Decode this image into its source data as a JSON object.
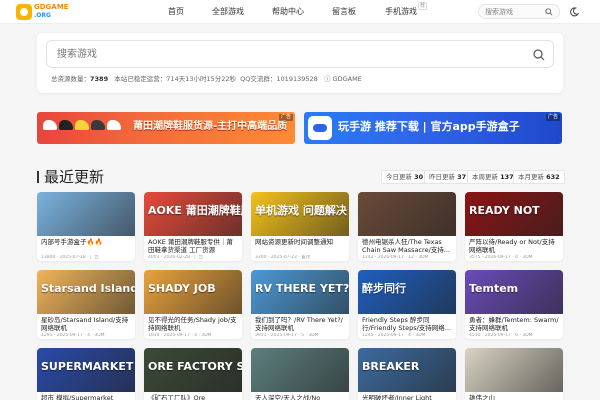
{
  "logo": {
    "line1": "GDGAME",
    "line2": ".ORG"
  },
  "nav": {
    "home": "首页",
    "all_games": "全部游戏",
    "help": "帮助中心",
    "guestbook": "留言板",
    "mobile_games": "手机游戏",
    "mobile_badge": "荐",
    "search_placeholder": "搜索游戏"
  },
  "search": {
    "placeholder": "搜索游戏"
  },
  "stats": {
    "total_label": "总资源数量：",
    "total_value": "7389",
    "uptime": "本站已稳定运营：714天13小时15分22秒",
    "qq_label": "QQ交流群：",
    "qq_value": "1019139528",
    "site": "GDGAME"
  },
  "banners": {
    "left_text": "莆田潮牌鞋服货源-主打中高端品质",
    "left_tag": "广告",
    "right_text": "玩手游 推荐下载 | 官方app手游盒子",
    "right_tag": "广告"
  },
  "section": {
    "title": "最近更新"
  },
  "filters": [
    {
      "label": "今日更新",
      "value": "30"
    },
    {
      "label": "昨日更新",
      "value": "37"
    },
    {
      "label": "本周更新",
      "value": "137"
    },
    {
      "label": "本月更新",
      "value": "632"
    }
  ],
  "cards": [
    {
      "title": "内部号手游盒子🔥🔥",
      "meta": "13800 · 2025-07-18 · 广告",
      "art": "",
      "color": "#7bb3e0"
    },
    {
      "title": "AOKE 莆田潮牌鞋服专供｜莆田鞋拿货渠道 工厂货源",
      "meta": "4003 · 2026-02-28 · 广告",
      "art": "AOKE 莆田潮牌鞋服",
      "color": "#e64a3a"
    },
    {
      "title": "网站资源更新时间调整通知",
      "meta": "3300 · 2025-07-23 · 置顶",
      "art": "单机游戏 问题解决",
      "color": "#f5c21a"
    },
    {
      "title": "德州电锯杀人狂/The Texas Chain Saw Massacre/支持...",
      "meta": "1242 · 2026-09-17 · 12 · 3DM",
      "art": "",
      "color": "#6b4a38"
    },
    {
      "title": "严阵以待/Ready or Not/支持网络联机",
      "meta": "3575 · 2026-09-17 · 4 · 3DM",
      "art": "READY NOT",
      "color": "#8a1414"
    },
    {
      "title": "星砂岛/Starsand Island/支持网络联机",
      "meta": "1291 · 2025-09-17 · 4 · 3DM",
      "art": "Starsand Island",
      "color": "#f0b45a"
    },
    {
      "title": "见不得光的任务/Shady job/支持网络联机",
      "meta": "1034 · 2025-09-17 · 4 · 3DM",
      "art": "SHADY JOB",
      "color": "#e9a23c"
    },
    {
      "title": "我们到了吗？/RV There Yet?/支持网络联机",
      "meta": "3951 · 2025-09-17 · 5 · 3DM",
      "art": "RV THERE YET?",
      "color": "#4d9ad6"
    },
    {
      "title": "Friendly Steps 醉步同行/Friendly Steps/支持网络...",
      "meta": "1245 · 2025-09-17 · 4 · 3DM",
      "art": "醉步同行",
      "color": "#1f5fbf"
    },
    {
      "title": "勇者：蜂群/Temtem: Swarm/支持网络联机",
      "meta": "4510 · 2025-09-17 · 6 · 3DM",
      "art": "Temtem",
      "color": "#6a4bb8"
    },
    {
      "title": "超市 模拟/Supermarket",
      "meta": "",
      "art": "SUPERMARKET CHAOS",
      "color": "#2a4aa8"
    },
    {
      "title": "《矿石工厂队》Ore",
      "meta": "",
      "art": "ORE FACTORY SQUAD",
      "color": "#3b4a36"
    },
    {
      "title": "天人深空/天人之战/No",
      "meta": "",
      "art": "",
      "color": "#5c7f7e"
    },
    {
      "title": "光明破坏者/Inner Light",
      "meta": "",
      "art": "BREAKER",
      "color": "#3c6a9e"
    },
    {
      "title": "雄伟之山",
      "meta": "",
      "art": "",
      "color": "#d8d3c2"
    }
  ]
}
